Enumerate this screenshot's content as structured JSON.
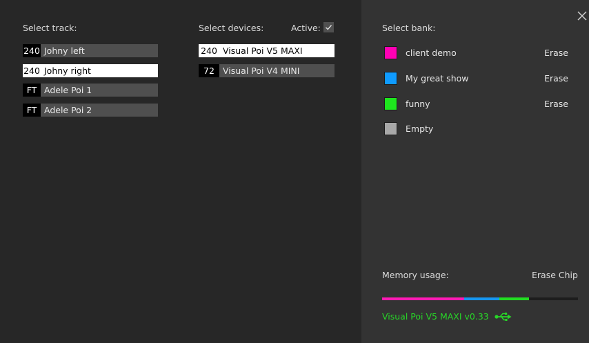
{
  "tracks": {
    "label": "Select track:",
    "items": [
      {
        "num": "240",
        "name": "Johny left",
        "selected": false
      },
      {
        "num": "240",
        "name": "Johny right",
        "selected": true
      },
      {
        "num": "FT",
        "name": "Adele Poi 1",
        "selected": false
      },
      {
        "num": "FT",
        "name": "Adele Poi 2",
        "selected": false
      }
    ]
  },
  "devices": {
    "label": "Select devices:",
    "active_label": "Active:",
    "active_checked": true,
    "items": [
      {
        "num": "240",
        "name": "Visual Poi V5 MAXI",
        "selected": true
      },
      {
        "num": "72",
        "name": "Visual Poi V4 MINI",
        "selected": false
      }
    ]
  },
  "banks": {
    "label": "Select bank:",
    "items": [
      {
        "name": "client demo",
        "color": "#ff00b4",
        "erase": "Erase"
      },
      {
        "name": "My great show",
        "color": "#0f9bff",
        "erase": "Erase"
      },
      {
        "name": "funny",
        "color": "#1ee61e",
        "erase": "Erase"
      },
      {
        "name": "Empty",
        "color": "#a8a8a8",
        "erase": ""
      }
    ]
  },
  "memory": {
    "label": "Memory usage:",
    "erase_chip": "Erase Chip",
    "segments": [
      {
        "color": "#ff1ab4",
        "fraction": 0.42
      },
      {
        "color": "#1696f0",
        "fraction": 0.18
      },
      {
        "color": "#22dd22",
        "fraction": 0.15
      }
    ]
  },
  "status": {
    "device_text": "Visual Poi V5 MAXI v0.33",
    "icon": "usb-icon",
    "color": "#28d628"
  },
  "close_icon": "close-icon"
}
